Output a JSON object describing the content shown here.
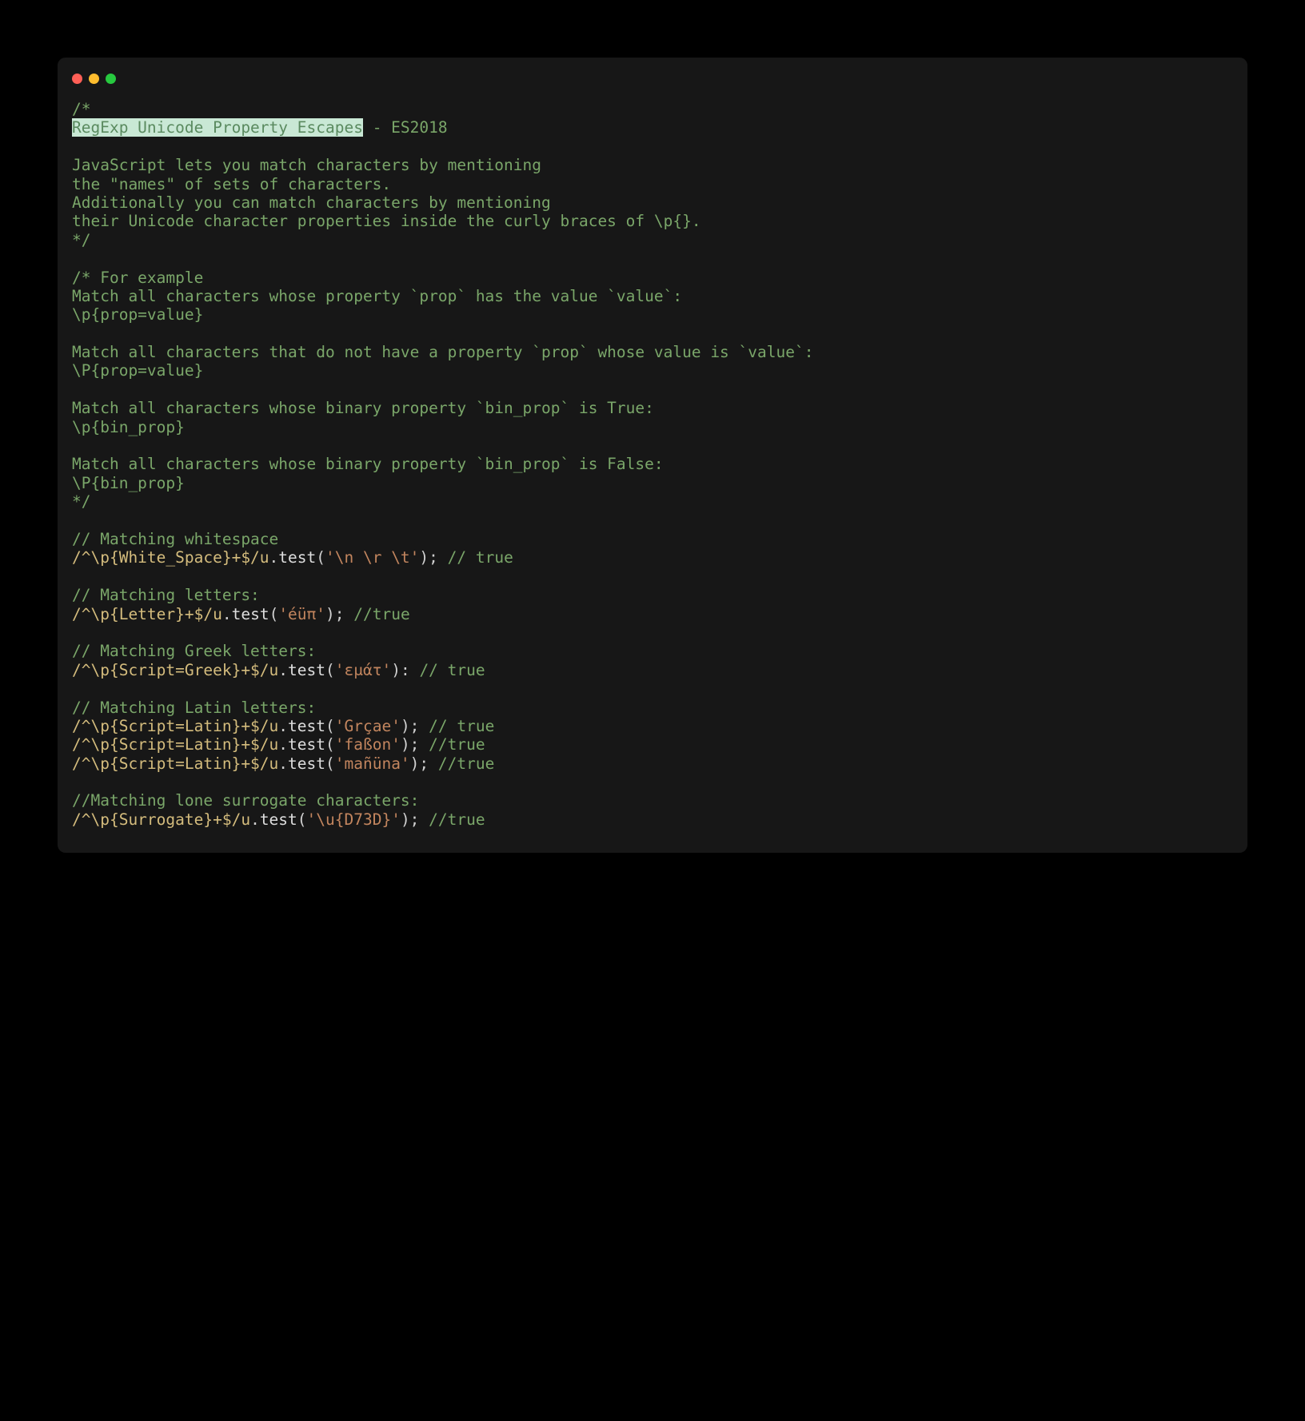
{
  "lines": {
    "l1": "/*",
    "l2a": "RegExp Unicode Property Escapes",
    "l2b": " - ES2018",
    "l3": "",
    "l4": "JavaScript lets you match characters by mentioning",
    "l5": "the \"names\" of sets of characters.",
    "l6": "Additionally you can match characters by mentioning",
    "l7": "their Unicode character properties inside the curly braces of \\p{}.",
    "l8": "*/",
    "l9": "",
    "l10": "/* For example",
    "l11": "Match all characters whose property `prop` has the value `value`:",
    "l12": "\\p{prop=value}",
    "l13": "",
    "l14": "Match all characters that do not have a property `prop` whose value is `value`:",
    "l15": "\\P{prop=value}",
    "l16": "",
    "l17": "Match all characters whose binary property `bin_prop` is True:",
    "l18": "\\p{bin_prop}",
    "l19": "",
    "l20": "Match all characters whose binary property `bin_prop` is False:",
    "l21": "\\P{bin_prop}",
    "l22": "*/",
    "l23": "",
    "l24": "// Matching whitespace",
    "r25": "/^\\p{White_Space}+$/u",
    "p25a": ".",
    "m25": "test",
    "p25b": "(",
    "s25": "'\\n \\r \\t'",
    "p25c": "); ",
    "c25": "// true",
    "l26": "",
    "l27": "// Matching letters:",
    "r28": "/^\\p{Letter}+$/u",
    "p28a": ".",
    "m28": "test",
    "p28b": "(",
    "s28": "'éüπ'",
    "p28c": "); ",
    "c28": "//true",
    "l29": "",
    "l30": "// Matching Greek letters:",
    "r31": "/^\\p{Script=Greek}+$/u",
    "p31a": ".",
    "m31": "test",
    "p31b": "(",
    "s31": "'εμάτ'",
    "p31c": "): ",
    "c31": "// true",
    "l32": "",
    "l33": "// Matching Latin letters:",
    "r34": "/^\\p{Script=Latin}+$/u",
    "p34a": ".",
    "m34": "test",
    "p34b": "(",
    "s34": "'Grçae'",
    "p34c": "); ",
    "c34": "// true",
    "r35": "/^\\p{Script=Latin}+$/u",
    "p35a": ".",
    "m35": "test",
    "p35b": "(",
    "s35": "'faßon'",
    "p35c": "); ",
    "c35": "//true",
    "r36": "/^\\p{Script=Latin}+$/u",
    "p36a": ".",
    "m36": "test",
    "p36b": "(",
    "s36": "'mañüna'",
    "p36c": "); ",
    "c36": "//true",
    "l37": "",
    "l38": "//Matching lone surrogate characters:",
    "r39": "/^\\p{Surrogate}+$/u",
    "p39a": ".",
    "m39": "test",
    "p39b": "(",
    "s39": "'\\u{D73D}'",
    "p39c": "); ",
    "c39": "//true"
  }
}
